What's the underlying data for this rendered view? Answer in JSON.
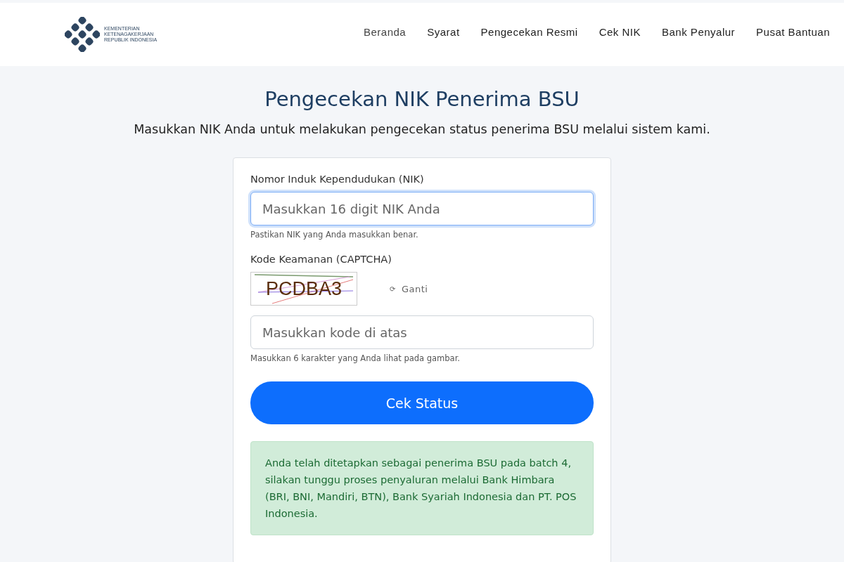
{
  "header": {
    "logo_lines": [
      "KEMENTERIAN",
      "KETENAGAKERJAAN",
      "REPUBLIK INDONESIA"
    ],
    "nav": [
      {
        "label": "Beranda",
        "selected": true
      },
      {
        "label": "Syarat",
        "selected": false
      },
      {
        "label": "Pengecekan Resmi",
        "selected": false
      },
      {
        "label": "Cek NIK",
        "selected": false
      },
      {
        "label": "Bank Penyalur",
        "selected": false
      },
      {
        "label": "Pusat Bantuan",
        "selected": false
      }
    ]
  },
  "title": "Pengecekan NIK Penerima BSU",
  "subtitle": "Masukkan NIK Anda untuk melakukan pengecekan status penerima BSU melalui sistem kami.",
  "form": {
    "nik": {
      "label": "Nomor Induk Kependudukan (NIK)",
      "placeholder": "Masukkan 16 digit NIK Anda",
      "focused": true,
      "hint": "Pastikan NIK yang Anda masukkan benar."
    },
    "captcha": {
      "label": "Kode Keamanan (CAPTCHA)",
      "code": "PCDBA3",
      "refresh_icon": "⟳",
      "refresh": "Ganti",
      "placeholder": "Masukkan kode di atas",
      "focused": false,
      "hint": "Masukkan 6 karakter yang Anda lihat pada gambar."
    },
    "submit": "Cek Status",
    "result": {
      "kind": "success",
      "text": "Anda telah ditetapkan sebagai penerima BSU pada batch 4, silakan tunggu proses penyaluran melalui Bank Himbara (BRI, BNI, Mandiri, BTN), Bank Syariah Indonesia dan PT. POS Indonesia."
    }
  }
}
